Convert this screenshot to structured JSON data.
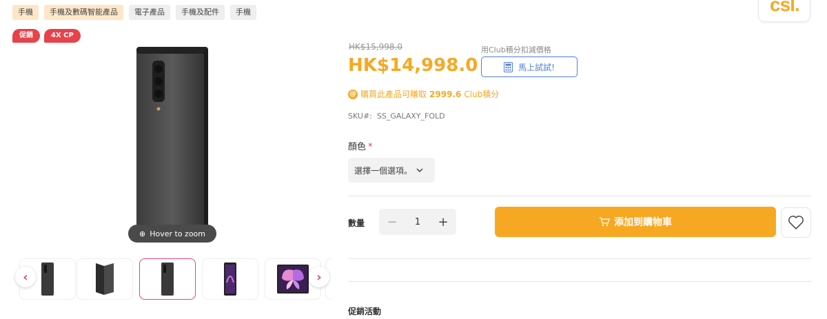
{
  "breadcrumbs": [
    {
      "label": "手機",
      "style": "orange"
    },
    {
      "label": "手機及數碼智能產品",
      "style": "orange"
    },
    {
      "label": "電子產品",
      "style": "gray"
    },
    {
      "label": "手機及配件",
      "style": "gray"
    },
    {
      "label": "手機",
      "style": "gray"
    }
  ],
  "logo": {
    "text": "csl."
  },
  "promo_badges": [
    "促銷",
    "4X CP"
  ],
  "gallery": {
    "zoom_hint": "Hover to zoom",
    "thumbnail_count": 6,
    "active_index": 2,
    "prev_icon": "‹",
    "next_icon": "›"
  },
  "product": {
    "original_price": "HK$15,998.0",
    "price": "HK$14,998.0",
    "club_label": "用Club積分扣減價格",
    "calc_button": "馬上試試!",
    "earn_prefix": "購買此產品可賺取",
    "earn_points": "2999.6",
    "earn_suffix": " Club積分",
    "sku_label": "SKU#:",
    "sku_value": "SS_GALAXY_FOLD"
  },
  "options": {
    "color_label": "顏色",
    "required_mark": "*",
    "select_placeholder": "選擇一個選項。"
  },
  "purchase": {
    "qty_label": "數量",
    "qty_value": "1",
    "minus": "−",
    "plus": "+",
    "add_to_cart": "添加到購物車"
  },
  "promotions": {
    "title": "促銷活動"
  },
  "colors": {
    "accent": "#f7a823",
    "badge": "#e8424a",
    "thumb_active": "#e0457b",
    "link": "#4a7fd6"
  }
}
